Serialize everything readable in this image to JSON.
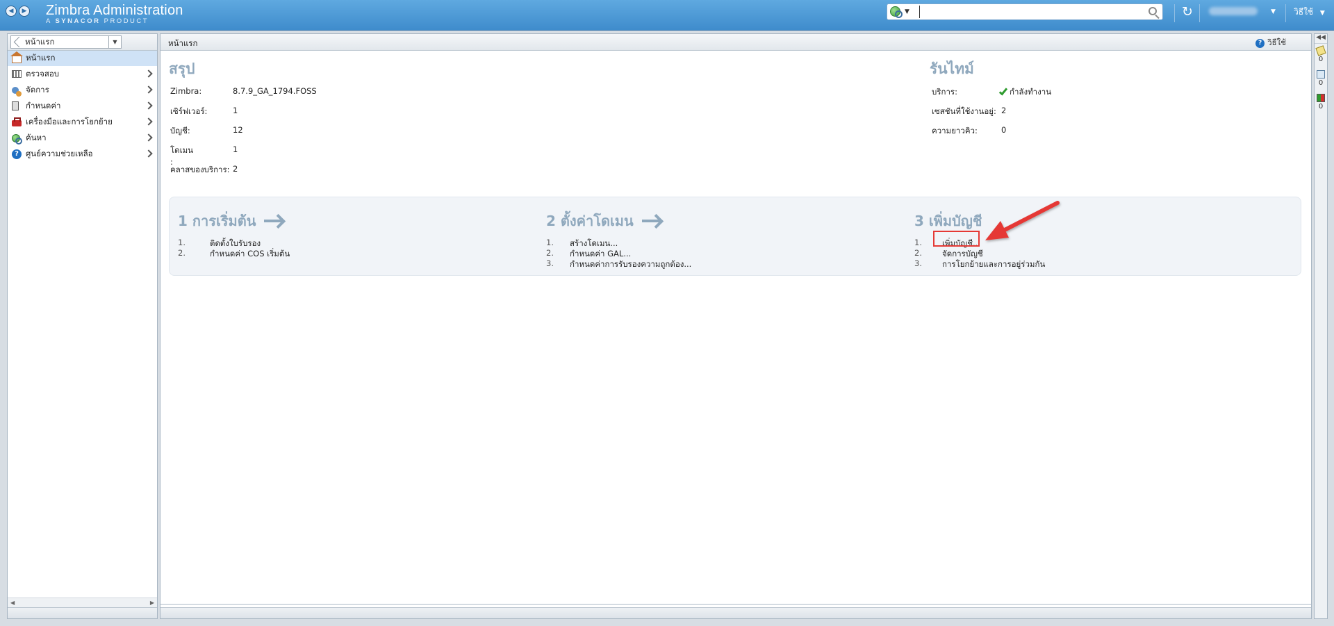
{
  "header": {
    "app_title": "Zimbra Administration",
    "app_subtitle_prefix": "A",
    "app_subtitle_brand": "SYNACOR",
    "app_subtitle_suffix": "PRODUCT",
    "search": {
      "value": "",
      "placeholder": ""
    },
    "help_label": "วิธีใช้"
  },
  "sidebar": {
    "breadcrumb": "หน้าแรก",
    "items": [
      {
        "label": "หน้าแรก",
        "icon": "home-icon",
        "active": true
      },
      {
        "label": "ตรวจสอบ",
        "icon": "monitor-icon"
      },
      {
        "label": "จัดการ",
        "icon": "manage-icon"
      },
      {
        "label": "กำหนดค่า",
        "icon": "configure-icon"
      },
      {
        "label": "เครื่องมือและการโยกย้าย",
        "icon": "toolbox-icon"
      },
      {
        "label": "ค้นหา",
        "icon": "search-globe-icon"
      },
      {
        "label": "ศูนย์ความช่วยเหลือ",
        "icon": "help-icon"
      }
    ]
  },
  "main": {
    "breadcrumb": "หน้าแรก",
    "help_label": "วิธีใช้",
    "summary": {
      "title": "สรุป",
      "rows": [
        {
          "label": "Zimbra:",
          "value": "8.7.9_GA_1794.FOSS"
        },
        {
          "label": "เซิร์ฟเวอร์:",
          "value": "1"
        },
        {
          "label": "บัญชี:",
          "value": "12"
        },
        {
          "label": "โดเมน :",
          "value": "1"
        },
        {
          "label": "คลาสของบริการ:",
          "value": "2"
        }
      ]
    },
    "runtime": {
      "title": "รันไทม์",
      "rows": [
        {
          "label": "บริการ:",
          "value": "กำลังทำงาน"
        },
        {
          "label": "เซสชันที่ใช้งานอยู่:",
          "value": "2"
        },
        {
          "label": "ความยาวคิว:",
          "value": "0"
        }
      ]
    },
    "getting_started": [
      {
        "title": "1 การเริ่มต้น",
        "steps": [
          {
            "num": "1.",
            "label": "ติดตั้งใบรับรอง"
          },
          {
            "num": "2.",
            "label": "กำหนดค่า COS เริ่มต้น"
          }
        ]
      },
      {
        "title": "2 ตั้งค่าโดเมน",
        "steps": [
          {
            "num": "1.",
            "label": "สร้างโดเมน..."
          },
          {
            "num": "2.",
            "label": "กำหนดค่า GAL..."
          },
          {
            "num": "3.",
            "label": "กำหนดค่าการรับรองความถูกต้อง..."
          }
        ]
      },
      {
        "title": "3 เพิ่มบัญชี",
        "steps": [
          {
            "num": "1.",
            "label": "เพิ่มบัญชี..."
          },
          {
            "num": "2.",
            "label": "จัดการบัญชี"
          },
          {
            "num": "3.",
            "label": "การโยกย้ายและการอยู่ร่วมกัน"
          }
        ]
      }
    ]
  },
  "right_strip": {
    "counters": [
      {
        "icon": "edit-note-icon",
        "value": "0"
      },
      {
        "icon": "task-icon",
        "value": "0"
      },
      {
        "icon": "alert-status-icon",
        "value": "0"
      }
    ]
  },
  "colors": {
    "header": "#4a9ad7",
    "section_title": "#8fa8bd",
    "active_nav": "#cfe2f6",
    "annotation": "#e53935"
  }
}
